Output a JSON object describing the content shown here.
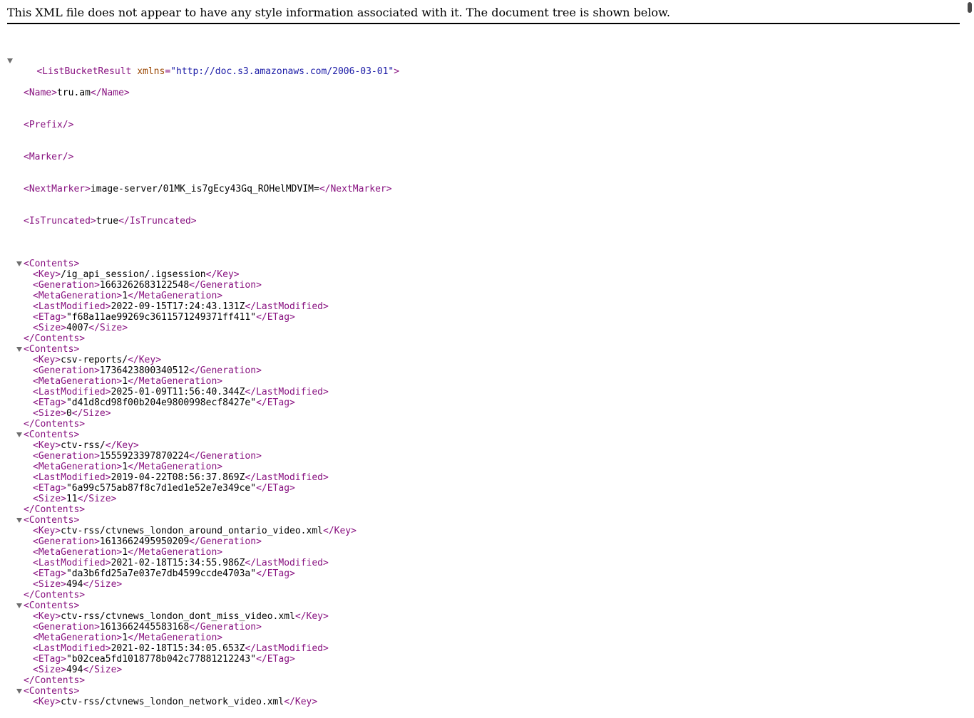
{
  "header": {
    "message": "This XML file does not appear to have any style information associated with it. The document tree is shown below."
  },
  "root": {
    "open": "<ListBucketResult",
    "attr_name": "xmlns",
    "attr_eq": "=",
    "attr_value": "\"http://doc.s3.amazonaws.com/2006-03-01\"",
    "close_bracket": ">"
  },
  "fields": {
    "name": {
      "open": "<Name>",
      "text": "tru.am",
      "close": "</Name>"
    },
    "prefix": {
      "tag": "<Prefix/>"
    },
    "marker": {
      "tag": "<Marker/>"
    },
    "next_marker": {
      "open": "<NextMarker>",
      "text": "image-server/01MK_is7gEcy43Gq_ROHelMDVIM=",
      "close": "</NextMarker>"
    },
    "is_truncated": {
      "open": "<IsTruncated>",
      "text": "true",
      "close": "</IsTruncated>"
    }
  },
  "tags": {
    "contents_open": "<Contents>",
    "contents_close": "</Contents>",
    "key_open": "<Key>",
    "key_close": "</Key>",
    "gen_open": "<Generation>",
    "gen_close": "</Generation>",
    "meta_open": "<MetaGeneration>",
    "meta_close": "</MetaGeneration>",
    "lm_open": "<LastModified>",
    "lm_close": "</LastModified>",
    "etag_open": "<ETag>",
    "etag_close": "</ETag>",
    "size_open": "<Size>",
    "size_close": "</Size>"
  },
  "contents": [
    {
      "key": "/ig_api_session/.igsession",
      "generation": "1663262683122548",
      "meta_generation": "1",
      "last_modified": "2022-09-15T17:24:43.131Z",
      "etag": "\"f68a11ae99269c3611571249371ff411\"",
      "size": "4007"
    },
    {
      "key": "csv-reports/",
      "generation": "1736423800340512",
      "meta_generation": "1",
      "last_modified": "2025-01-09T11:56:40.344Z",
      "etag": "\"d41d8cd98f00b204e9800998ecf8427e\"",
      "size": "0"
    },
    {
      "key": "ctv-rss/",
      "generation": "1555923397870224",
      "meta_generation": "1",
      "last_modified": "2019-04-22T08:56:37.869Z",
      "etag": "\"6a99c575ab87f8c7d1ed1e52e7e349ce\"",
      "size": "11"
    },
    {
      "key": "ctv-rss/ctvnews_london_around_ontario_video.xml",
      "generation": "1613662495950209",
      "meta_generation": "1",
      "last_modified": "2021-02-18T15:34:55.986Z",
      "etag": "\"da3b6fd25a7e037e7db4599ccde4703a\"",
      "size": "494"
    },
    {
      "key": "ctv-rss/ctvnews_london_dont_miss_video.xml",
      "generation": "1613662445583168",
      "meta_generation": "1",
      "last_modified": "2021-02-18T15:34:05.653Z",
      "etag": "\"b02cea5fd1018778b042c77881212243\"",
      "size": "494"
    },
    {
      "key": "ctv-rss/ctvnews_london_network_video.xml"
    }
  ],
  "colors": {
    "tag": "#881280",
    "attr_name": "#994500",
    "attr_value": "#1a1aa6",
    "text": "#000000",
    "toggle": "#6e6e6e"
  },
  "icons": {
    "toggle": "expand-collapse-triangle-icon"
  }
}
